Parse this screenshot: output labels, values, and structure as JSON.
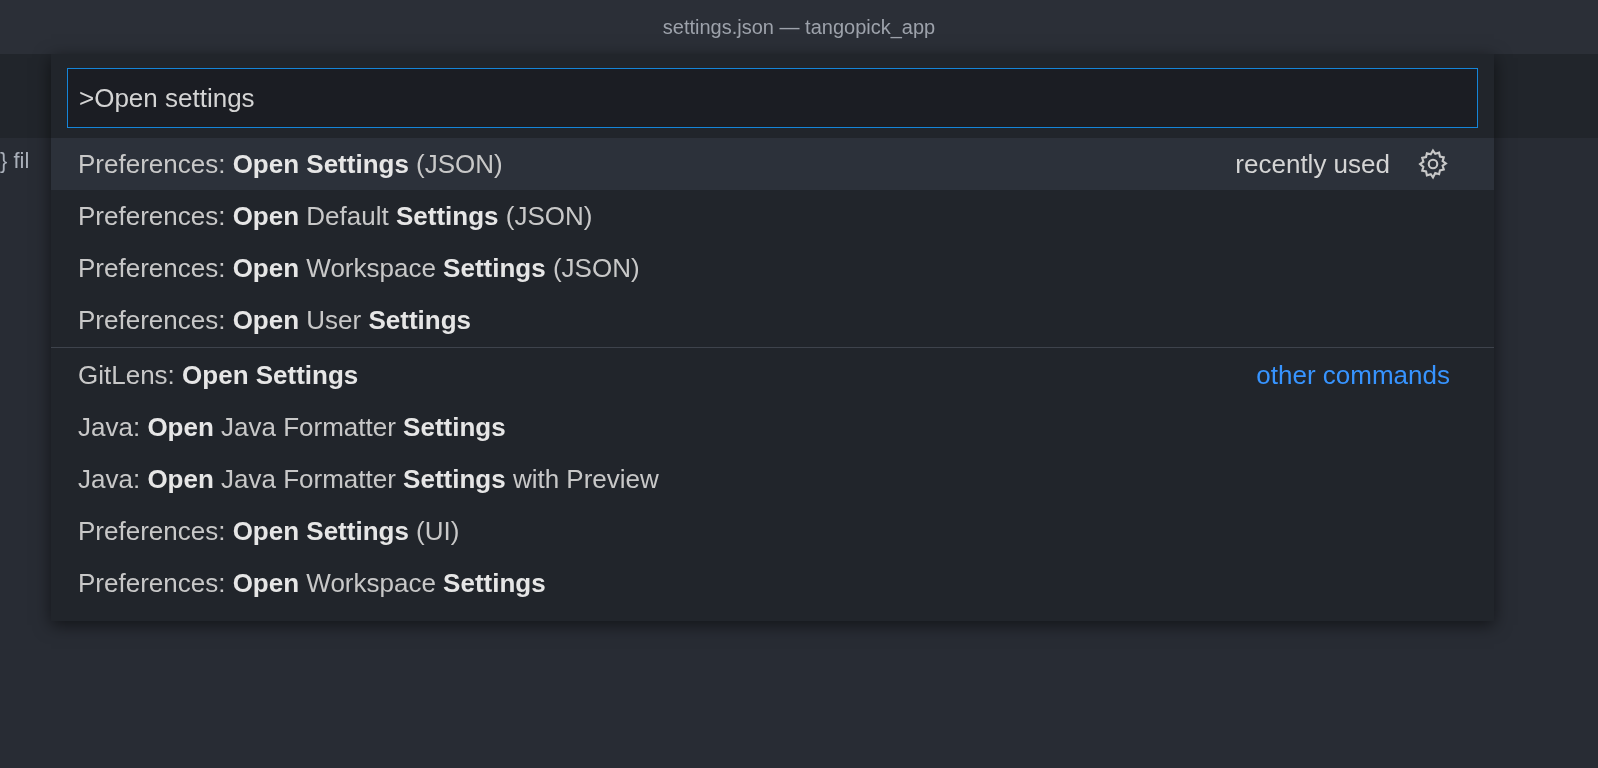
{
  "window": {
    "title": "settings.json — tangopick_app"
  },
  "editor": {
    "breadcrumb": "} fil"
  },
  "palette": {
    "query": ">Open settings",
    "groups": [
      {
        "items": [
          {
            "label": "Preferences: **Open Settings** (JSON)",
            "detail": "recently used",
            "gear": true,
            "selected": true
          },
          {
            "label": "Preferences: **Open** Default **Settings** (JSON)",
            "gear": false,
            "selected": false
          },
          {
            "label": "Preferences: **Open** Workspace **Settings** (JSON)",
            "gear": false,
            "selected": false
          },
          {
            "label": "Preferences: **Open** User **Settings**",
            "gear": false,
            "selected": false
          }
        ]
      },
      {
        "heading": "other commands",
        "items": [
          {
            "label": "GitLens: **Open Settings**",
            "gear": false,
            "selected": false
          },
          {
            "label": "Java: **Open** Java Formatter **Settings**",
            "gear": false,
            "selected": false
          },
          {
            "label": "Java: **Open** Java Formatter **Settings** with Preview",
            "gear": false,
            "selected": false
          },
          {
            "label": "Preferences: **Open Settings** (UI)",
            "gear": false,
            "selected": false
          },
          {
            "label": "Preferences: **Open** Workspace **Settings**",
            "gear": false,
            "selected": false
          }
        ]
      }
    ]
  }
}
